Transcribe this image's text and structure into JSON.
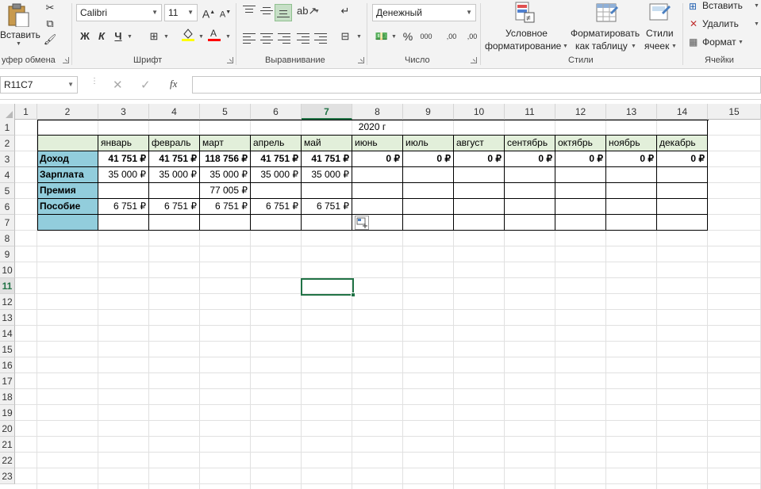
{
  "ribbon": {
    "clipboard": {
      "paste_label": "Вставить",
      "group_label": "уфер обмена"
    },
    "font": {
      "family": "Calibri",
      "size": "11",
      "bold": "Ж",
      "italic": "К",
      "underline": "Ч",
      "grow": "A",
      "shrink": "A",
      "group_label": "Шрифт"
    },
    "alignment": {
      "group_label": "Выравнивание"
    },
    "number": {
      "format": "Денежный",
      "percent": "%",
      "thousands": "000",
      "inc_decimal": ",00",
      "dec_decimal": ",00",
      "group_label": "Число"
    },
    "styles": {
      "conditional_1": "Условное",
      "conditional_2": "форматирование",
      "table_1": "Форматировать",
      "table_2": "как таблицу",
      "cell_1": "Стили",
      "cell_2": "ячеек",
      "group_label": "Стили"
    },
    "cells": {
      "insert": "Вставить",
      "delete": "Удалить",
      "format": "Формат",
      "group_label": "Ячейки"
    }
  },
  "formula_bar": {
    "name_box": "R11C7",
    "fx": "fx",
    "content": ""
  },
  "sheet": {
    "columns": [
      "1",
      "2",
      "3",
      "4",
      "5",
      "6",
      "7",
      "8",
      "9",
      "10",
      "11",
      "12",
      "13",
      "14",
      "15"
    ],
    "rows": [
      "1",
      "2",
      "3",
      "4",
      "5",
      "6",
      "7",
      "8",
      "9",
      "10",
      "11",
      "12",
      "13",
      "14",
      "15",
      "16",
      "17",
      "18",
      "19",
      "20",
      "21",
      "22",
      "23"
    ],
    "selected_column": "7",
    "selected_row": "11",
    "title": "2020 г",
    "months": [
      "январь",
      "февраль",
      "март",
      "апрель",
      "май",
      "июнь",
      "июль",
      "август",
      "сентябрь",
      "октябрь",
      "ноябрь",
      "декабрь"
    ],
    "table_rows": [
      {
        "label": "Доход",
        "bold": true,
        "values": [
          "41 751 ₽",
          "41 751 ₽",
          "118 756 ₽",
          "41 751 ₽",
          "41 751 ₽",
          "0 ₽",
          "0 ₽",
          "0 ₽",
          "0 ₽",
          "0 ₽",
          "0 ₽",
          "0 ₽"
        ]
      },
      {
        "label": "Зарплата",
        "bold": false,
        "values": [
          "35 000 ₽",
          "35 000 ₽",
          "35 000 ₽",
          "35 000 ₽",
          "35 000 ₽",
          "",
          "",
          "",
          "",
          "",
          "",
          ""
        ]
      },
      {
        "label": "Премия",
        "bold": false,
        "values": [
          "",
          "",
          "77 005 ₽",
          "",
          "",
          "",
          "",
          "",
          "",
          "",
          "",
          ""
        ]
      },
      {
        "label": "Пособие",
        "bold": false,
        "values": [
          "6 751 ₽",
          "6 751 ₽",
          "6 751 ₽",
          "6 751 ₽",
          "6 751 ₽",
          "",
          "",
          "",
          "",
          "",
          "",
          ""
        ]
      },
      {
        "label": "",
        "bold": false,
        "values": [
          "",
          "",
          "",
          "",
          "",
          "",
          "",
          "",
          "",
          "",
          "",
          ""
        ]
      }
    ]
  },
  "colors": {
    "accent": "#217346",
    "header_fill": "#e2efda",
    "label_fill": "#92cddc"
  }
}
